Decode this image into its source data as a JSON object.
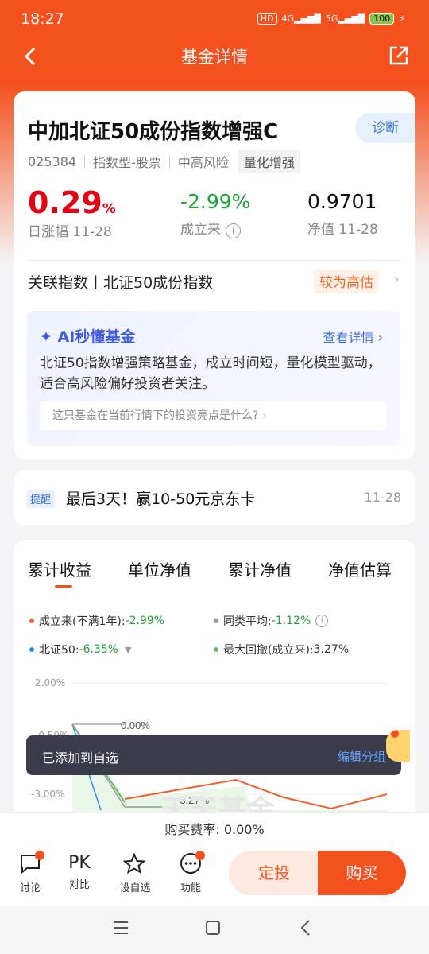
{
  "status": {
    "time": "18:27",
    "hd": "HD",
    "net1": "4G",
    "net2": "5G",
    "battery": "100"
  },
  "nav": {
    "title": "基金详情"
  },
  "fund": {
    "name": "中加北证50成份指数增强C",
    "diagnose": "诊断",
    "code": "025384",
    "type": "指数型-股票",
    "risk": "中高风险",
    "tag": "量化增强",
    "daily_value": "0.29",
    "daily_unit": "%",
    "daily_label": "日涨幅 11-28",
    "since_value": "-2.99%",
    "since_label": "成立来",
    "nav_value": "0.9701",
    "nav_label": "净值 11-28",
    "related_label": "关联指数丨北证50成份指数",
    "valuation": "较为高估"
  },
  "ai": {
    "title": "AI秒懂基金",
    "more": "查看详情",
    "desc": "北证50指数增强策略基金，成立时间短，量化模型驱动，适合高风险偏好投资者关注。",
    "question": "这只基金在当前行情下的投资亮点是什么?"
  },
  "remind": {
    "tag": "提醒",
    "text": "最后3天！赢10-50元京东卡",
    "date": "11-28"
  },
  "tabs": [
    "累计收益",
    "单位净值",
    "累计净值",
    "净值估算"
  ],
  "legend": [
    {
      "label": "成立来(不满1年):",
      "value": "-2.99%",
      "color": "#f0622d",
      "value_color": "#1ea33a"
    },
    {
      "label": "同类平均:",
      "value": "-1.12%",
      "color": "#999999",
      "value_color": "#1ea33a"
    },
    {
      "label": "北证50:",
      "value": "-6.35%",
      "color": "#2e8ee6",
      "value_color": "#1ea33a"
    },
    {
      "label": "最大回撤(成立来):",
      "value": "3.27%",
      "color": "#5cc35c",
      "value_color": "#333333"
    }
  ],
  "chart": {
    "y_ticks": [
      "2.00%",
      "-0.50%",
      "-3.00%"
    ],
    "annotations": [
      "0.00%",
      "-3.27%"
    ],
    "watermark": "天天基金"
  },
  "toast": {
    "text": "已添加到自选",
    "action": "编辑分组"
  },
  "fee": {
    "label": "购买费率:",
    "value": "0.00%"
  },
  "bottom": {
    "items": [
      "讨论",
      "对比",
      "设自选",
      "功能"
    ],
    "pk": "PK",
    "dingtou": "定投",
    "buy": "购买"
  }
}
